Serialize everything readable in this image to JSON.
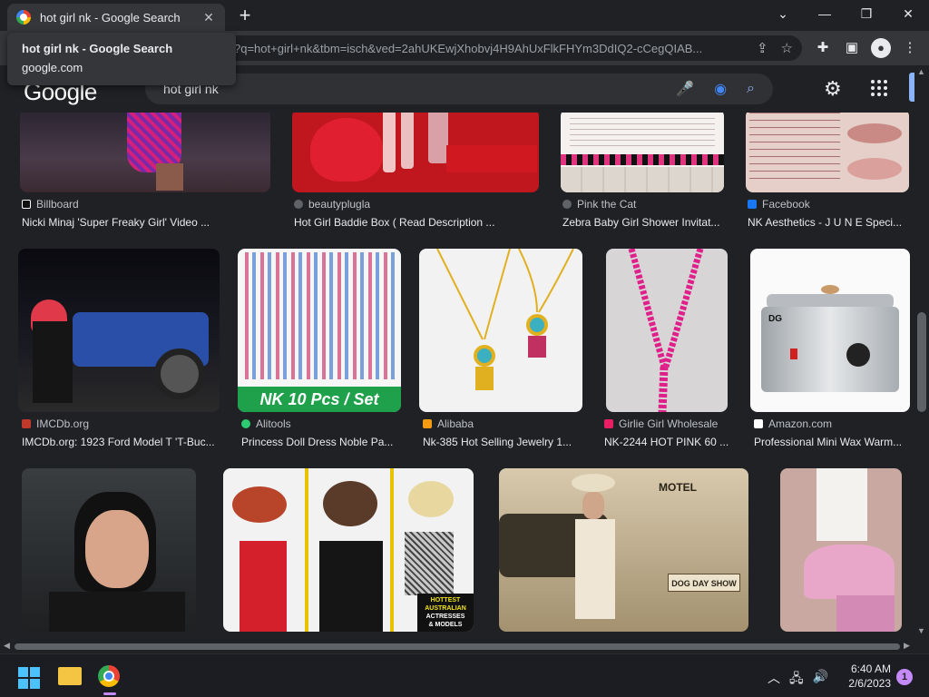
{
  "browser": {
    "tab_title": "hot girl nk - Google Search",
    "url": "?q=hot+girl+nk&tbm=isch&ved=2ahUKEwjXhobvj4H9AhUxFlkFHYm3DdIQ2-cCegQIAB...",
    "tooltip_title": "hot girl nk - Google Search",
    "tooltip_domain": "google.com"
  },
  "google": {
    "logo": "Google",
    "query": "hot girl nk"
  },
  "results": [
    {
      "source": "Billboard",
      "caption": "Nicki Minaj 'Super Freaky Girl' Video ...",
      "fav_color": "#111111"
    },
    {
      "source": "beautyplugla",
      "caption": "Hot Girl Baddie Box ( Read Description ...",
      "fav_color": "#5f6368"
    },
    {
      "source": "Pink the Cat",
      "caption": "Zebra Baby Girl Shower Invitat...",
      "fav_color": "#5f6368"
    },
    {
      "source": "Facebook",
      "caption": "NK Aesthetics - J U N E Speci...",
      "fav_color": "#1877f2"
    },
    {
      "source": "IMCDb.org",
      "caption": "IMCDb.org: 1923 Ford Model T 'T-Buc...",
      "fav_color": "#c0392b"
    },
    {
      "source": "Alitools",
      "caption": "Princess Doll Dress Noble Pa...",
      "fav_color": "#2ecc71"
    },
    {
      "source": "Alibaba",
      "caption": "Nk-385 Hot Selling Jewelry 1...",
      "fav_color": "#f39c12"
    },
    {
      "source": "Girlie Girl Wholesale",
      "caption": "NK-2244 HOT PINK 60 ...",
      "fav_color": "#e91e63"
    },
    {
      "source": "Amazon.com",
      "caption": "Professional Mini Wax Warm...",
      "fav_color": "#ffffff"
    }
  ],
  "image_overlays": {
    "doll_banner": "NK 10 Pcs / Set",
    "actresses_banner_1": "HOTTEST",
    "actresses_banner_2": "AUSTRALIAN",
    "actresses_banner_3": "ACTRESSES",
    "actresses_banner_4": "& MODELS",
    "motel_sign": "MOTEL",
    "dog_sign": "DOG DAY SHOW",
    "wax_brand": "DG"
  },
  "taskbar": {
    "time": "6:40 AM",
    "date": "2/6/2023",
    "notifications": "1"
  },
  "colors": {
    "page_bg": "#202124",
    "toolbar_bg": "#35363a",
    "accent_blue": "#8ab4f8"
  }
}
